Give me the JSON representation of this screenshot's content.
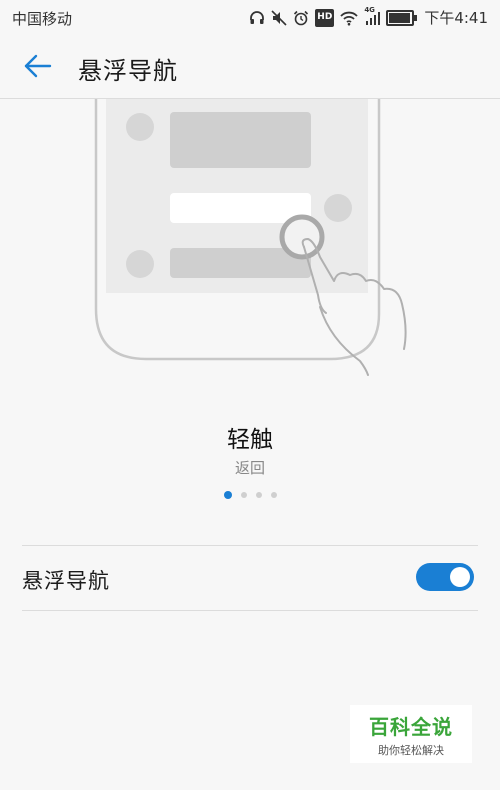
{
  "status_bar": {
    "carrier": "中国移动",
    "hd_label": "HD",
    "network_label": "4G",
    "time": "下午4:41",
    "battery_level": 0.85,
    "icons": [
      "headphones-icon",
      "mute-icon",
      "alarm-icon",
      "hd-icon",
      "wifi-icon",
      "signal-icon",
      "battery-icon"
    ]
  },
  "app_bar": {
    "title": "悬浮导航",
    "back_icon": "back-arrow-icon"
  },
  "gesture": {
    "title": "轻触",
    "description": "返回",
    "page_count": 4,
    "active_page": 1
  },
  "settings": {
    "floating_nav_label": "悬浮导航",
    "floating_nav_enabled": true
  },
  "watermark": {
    "main": "百科全说",
    "sub": "助你轻松解决"
  },
  "colors": {
    "accent": "#1a7fd4",
    "background": "#f7f7f7",
    "watermark_green": "#3aa53a"
  }
}
